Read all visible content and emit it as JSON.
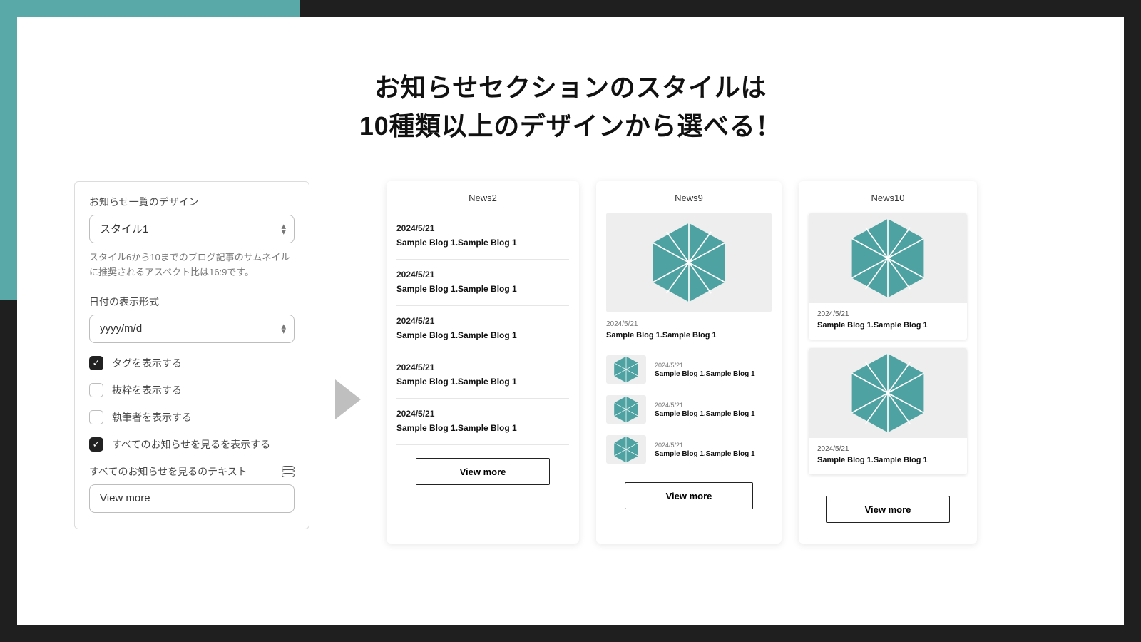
{
  "headline_line1": "お知らせセクションのスタイルは",
  "headline_line2": "10種類以上のデザインから選べる！",
  "panel": {
    "design_label": "お知らせ一覧のデザイン",
    "design_value": "スタイル1",
    "design_help": "スタイル6から10までのブログ記事のサムネイルに推奨されるアスペクト比は16:9です。",
    "date_label": "日付の表示形式",
    "date_value": "yyyy/m/d",
    "chk_tags": "タグを表示する",
    "chk_excerpt": "抜粋を表示する",
    "chk_author": "執筆者を表示する",
    "chk_showall": "すべてのお知らせを見るを表示する",
    "viewmore_text_label": "すべてのお知らせを見るのテキスト",
    "viewmore_text_value": "View more"
  },
  "common": {
    "view_more": "View more",
    "sample_date": "2024/5/21",
    "sample_title": "Sample Blog 1.Sample Blog 1"
  },
  "previews": {
    "news2_title": "News2",
    "news9_title": "News9",
    "news10_title": "News10"
  }
}
